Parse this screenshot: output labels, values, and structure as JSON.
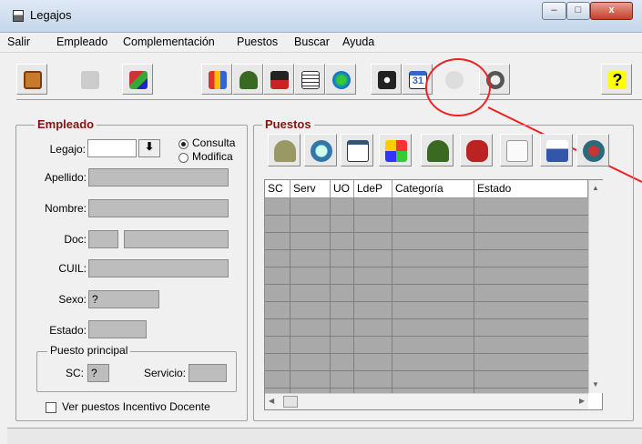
{
  "window": {
    "title": "Legajos",
    "min": "–",
    "max": "□",
    "close": "x"
  },
  "menu": [
    "Salir",
    "Empleado",
    "Complementación",
    "Puestos",
    "Buscar",
    "Ayuda"
  ],
  "toolbar": {
    "icons": [
      "exit-door-icon",
      "arrow-back-icon",
      "books-icon",
      "family-icon",
      "soldier-icon",
      "graduation-icon",
      "document-icon",
      "globe-icon",
      "camera-icon",
      "calendar-icon",
      "dollar-icon",
      "magnifier-pc-icon",
      "help-icon"
    ],
    "calendar_text": "31",
    "help_text": "?"
  },
  "empleado": {
    "group_label": "Empleado",
    "legajo_label": "Legajo:",
    "legajo_value": "",
    "download_glyph": "⬇",
    "radio_consulta": "Consulta",
    "radio_modifica": "Modifica",
    "apellido_label": "Apellido:",
    "nombre_label": "Nombre:",
    "doc_label": "Doc:",
    "cuil_label": "CUIL:",
    "sexo_label": "Sexo:",
    "sexo_value": "?",
    "estado_label": "Estado:",
    "puesto_principal": {
      "label": "Puesto principal",
      "sc_label": "SC:",
      "sc_value": "?",
      "servicio_label": "Servicio:"
    },
    "checkbox_label": "Ver puestos Incentivo Docente"
  },
  "puestos": {
    "group_label": "Puestos",
    "columns": [
      "SC",
      "Serv",
      "UO",
      "LdeP",
      "Categoría",
      "Estado"
    ],
    "scroll_up": "▲",
    "scroll_down": "▼",
    "scroll_left": "◀",
    "scroll_right": "▶",
    "buttons": [
      "tree-icon",
      "magnifier-icon",
      "calendar-list-icon",
      "arrows-icon",
      "soldier-icon",
      "money-bag-icon",
      "certificate-icon",
      "computer-person-icon",
      "search-person-icon"
    ]
  },
  "colors": {
    "group_label": "#8a1111",
    "highlight": "#e22222",
    "grid_bg": "#a9a9a9"
  }
}
